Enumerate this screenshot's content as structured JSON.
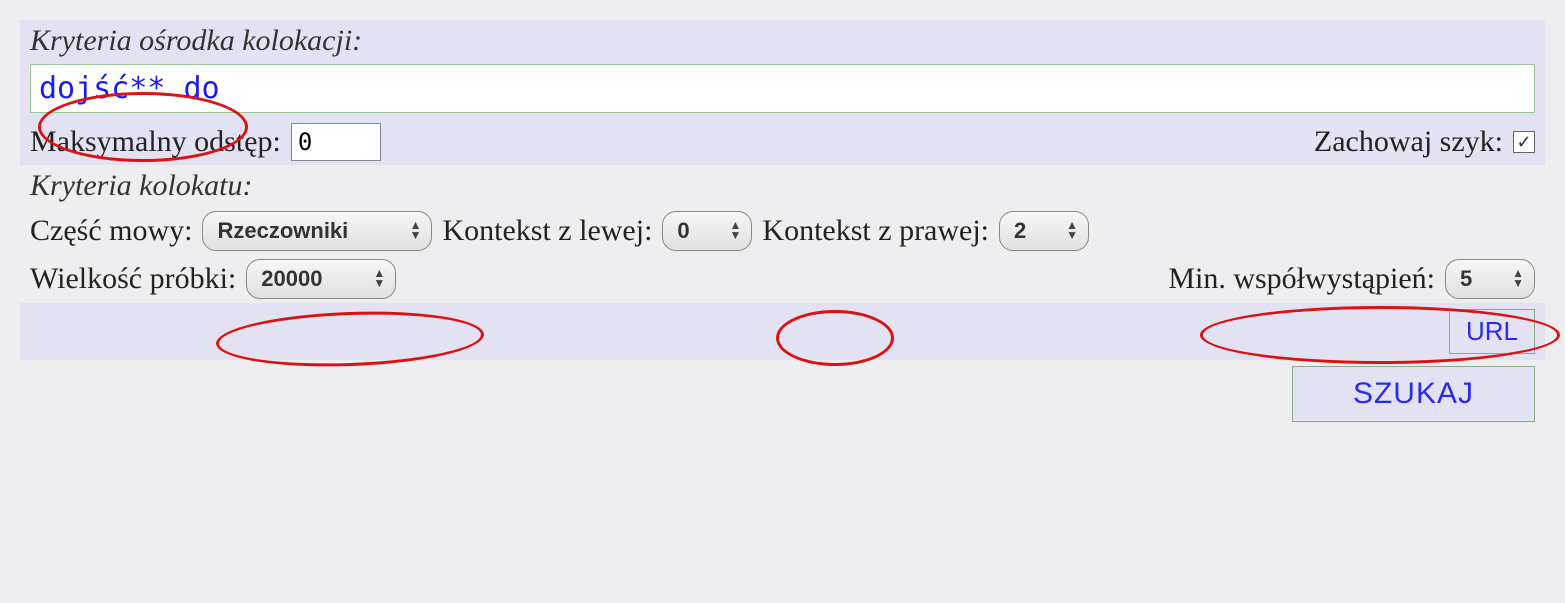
{
  "section1_title": "Kryteria ośrodka kolokacji:",
  "query_value": "dojść** do",
  "max_gap_label": "Maksymalny odstęp:",
  "max_gap_value": "0",
  "preserve_order_label": "Zachowaj szyk:",
  "preserve_order_checked": "✓",
  "section2_title": "Kryteria kolokatu:",
  "pos_label": "Część mowy:",
  "pos_value": "Rzeczowniki",
  "ctx_left_label": "Kontekst z lewej:",
  "ctx_left_value": "0",
  "ctx_right_label": "Kontekst z prawej:",
  "ctx_right_value": "2",
  "sample_label": "Wielkość próbki:",
  "sample_value": "20000",
  "mincooc_label": "Min. współwystąpień:",
  "mincooc_value": "5",
  "url_label": "URL",
  "search_label": "SZUKAJ"
}
